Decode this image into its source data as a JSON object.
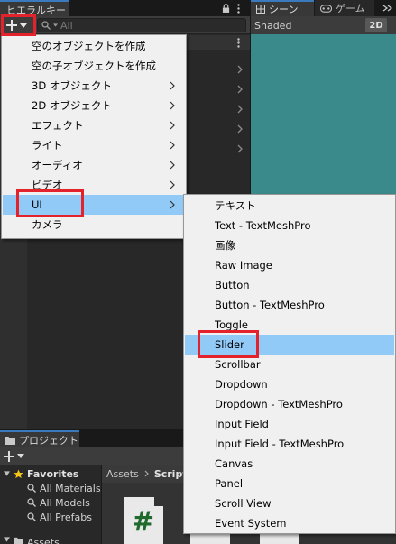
{
  "hierarchy": {
    "tab_title": "ヒエラルキー",
    "search_placeholder": "All"
  },
  "scene": {
    "tabs": [
      {
        "label": "シーン"
      },
      {
        "label": "ゲーム"
      }
    ],
    "shading_mode": "Shaded",
    "mode_2d_label": "2D"
  },
  "project": {
    "tab_title": "プロジェクト",
    "favorites_label": "Favorites",
    "favorites": [
      "All Materials",
      "All Models",
      "All Prefabs"
    ],
    "assets_partial_label": "Assets",
    "breadcrumb": [
      "Assets",
      "Script"
    ],
    "script_icon_glyph": "#"
  },
  "create_menu": {
    "items": [
      {
        "label": "空のオブジェクトを作成",
        "submenu": false
      },
      {
        "label": "空の子オブジェクトを作成",
        "submenu": false
      },
      {
        "label": "3D オブジェクト",
        "submenu": true
      },
      {
        "label": "2D オブジェクト",
        "submenu": true
      },
      {
        "label": "エフェクト",
        "submenu": true
      },
      {
        "label": "ライト",
        "submenu": true
      },
      {
        "label": "オーディオ",
        "submenu": true
      },
      {
        "label": "ビデオ",
        "submenu": true
      },
      {
        "label": "UI",
        "submenu": true,
        "highlighted": true
      },
      {
        "label": "カメラ",
        "submenu": false
      }
    ]
  },
  "ui_submenu": {
    "items": [
      {
        "label": "テキスト"
      },
      {
        "label": "Text - TextMeshPro"
      },
      {
        "label": "画像"
      },
      {
        "label": "Raw Image"
      },
      {
        "label": "Button"
      },
      {
        "label": "Button - TextMeshPro"
      },
      {
        "label": "Toggle"
      },
      {
        "label": "Slider",
        "highlighted": true
      },
      {
        "label": "Scrollbar"
      },
      {
        "label": "Dropdown"
      },
      {
        "label": "Dropdown - TextMeshPro"
      },
      {
        "label": "Input Field"
      },
      {
        "label": "Input Field - TextMeshPro"
      },
      {
        "label": "Canvas"
      },
      {
        "label": "Panel"
      },
      {
        "label": "Scroll View"
      },
      {
        "label": "Event System"
      }
    ]
  },
  "colors": {
    "annotation_red": "#e3222c",
    "menu_highlight": "#91c9f7",
    "menu_background": "#f0f0f0",
    "scene_background": "#3a8a8c",
    "favorite_star": "#f5c518",
    "script_hash": "#1f6a2c"
  }
}
